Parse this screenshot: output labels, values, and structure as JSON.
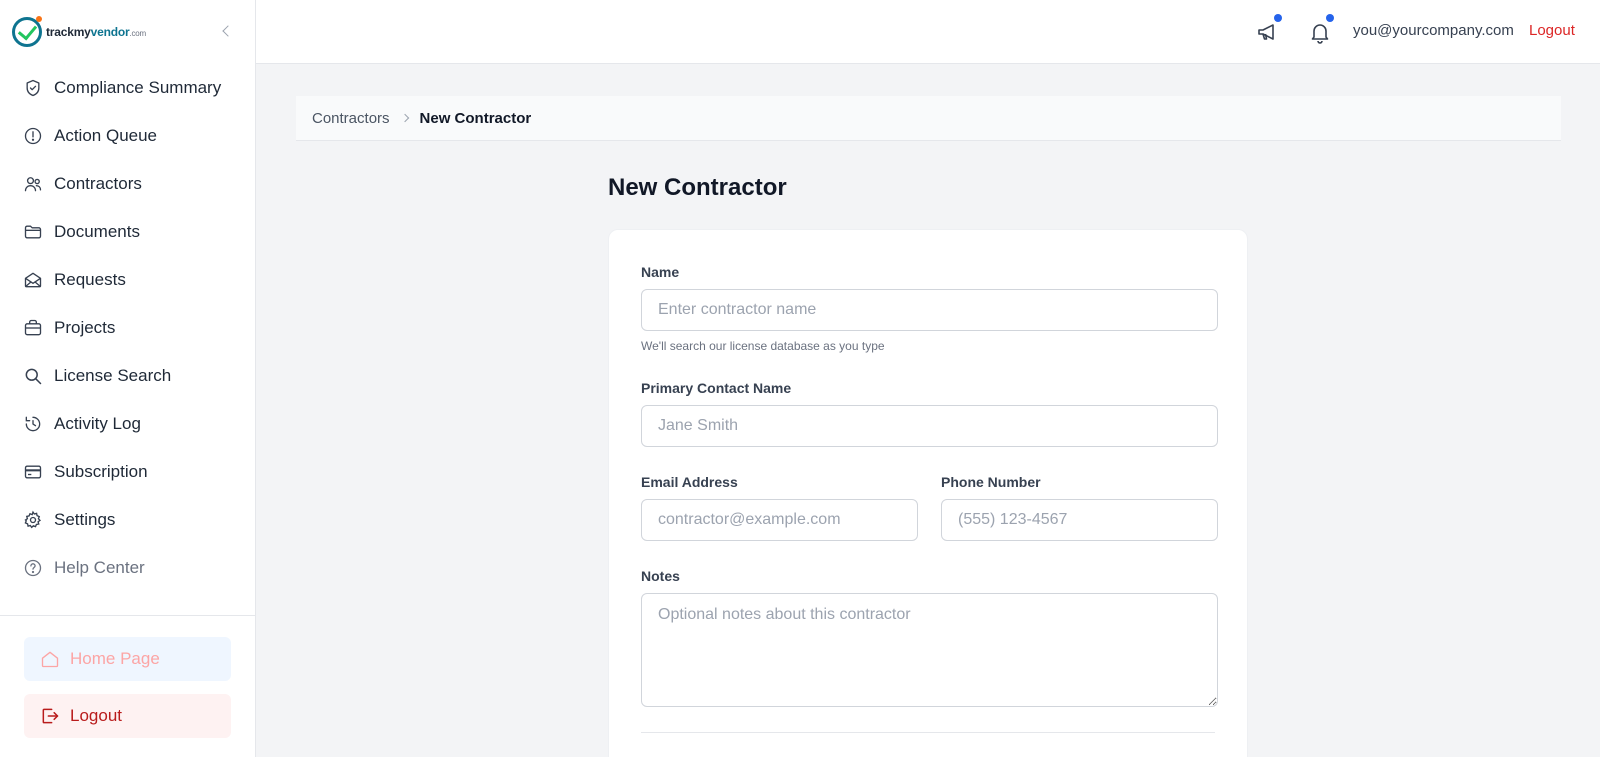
{
  "brand": {
    "name_part1": "trackmy",
    "name_part2": "vendor",
    "suffix": ".com"
  },
  "sidebar": {
    "items": [
      {
        "label": "Compliance Summary",
        "icon": "shield-check-icon"
      },
      {
        "label": "Action Queue",
        "icon": "alert-circle-icon"
      },
      {
        "label": "Contractors",
        "icon": "users-icon"
      },
      {
        "label": "Documents",
        "icon": "folder-icon"
      },
      {
        "label": "Requests",
        "icon": "mail-open-icon"
      },
      {
        "label": "Projects",
        "icon": "briefcase-icon"
      },
      {
        "label": "License Search",
        "icon": "search-icon"
      },
      {
        "label": "Activity Log",
        "icon": "history-icon"
      },
      {
        "label": "Subscription",
        "icon": "credit-card-icon"
      },
      {
        "label": "Settings",
        "icon": "gear-icon"
      },
      {
        "label": "Help Center",
        "icon": "help-circle-icon"
      }
    ],
    "home_button": "Home Page",
    "logout_button": "Logout"
  },
  "topbar": {
    "user_email": "you@yourcompany.com",
    "logout": "Logout"
  },
  "breadcrumb": {
    "parent": "Contractors",
    "current": "New Contractor"
  },
  "page": {
    "title": "New Contractor"
  },
  "form": {
    "name": {
      "label": "Name",
      "placeholder": "Enter contractor name",
      "value": "",
      "help": "We'll search our license database as you type"
    },
    "contact": {
      "label": "Primary Contact Name",
      "placeholder": "Jane Smith",
      "value": ""
    },
    "email": {
      "label": "Email Address",
      "placeholder": "contractor@example.com",
      "value": ""
    },
    "phone": {
      "label": "Phone Number",
      "placeholder": "(555) 123-4567",
      "value": ""
    },
    "notes": {
      "label": "Notes",
      "placeholder": "Optional notes about this contractor",
      "value": ""
    }
  },
  "colors": {
    "accent": "#dc2626",
    "notification_dot": "#2563eb",
    "brand_teal": "#0e7490",
    "brand_green": "#22c55e"
  }
}
